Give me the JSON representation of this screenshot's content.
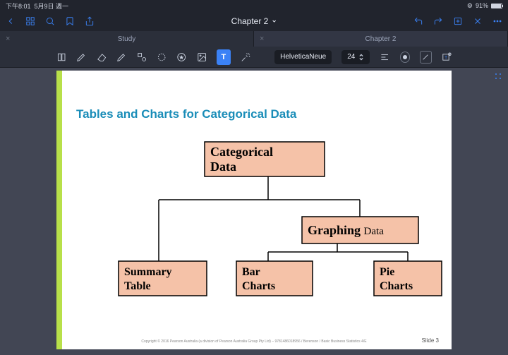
{
  "status": {
    "time": "下午8:01",
    "date": "5月9日 週一",
    "battery": "91%"
  },
  "titlebar": {
    "title": "Chapter 2"
  },
  "tabs": {
    "left": "Study",
    "right": "Chapter 2"
  },
  "toolbar": {
    "font": "HelveticaNeue",
    "size": "24",
    "text_tool": "T"
  },
  "slide": {
    "title": "Tables and Charts for Categorical Data",
    "copyright": "Copyright © 2016 Pearson Australia (a division of Pearson Australia Group Pty Ltd) – 9781486018956 / Berenson / Basic Business Statistics 4/E",
    "number": "Slide 3"
  },
  "diagram": {
    "root": "Categorical Data",
    "left": "Summary Table",
    "right_parent": {
      "bold": "Graphing",
      "rest": "Data"
    },
    "child1": "Bar Charts",
    "child2": "Pie Charts"
  }
}
